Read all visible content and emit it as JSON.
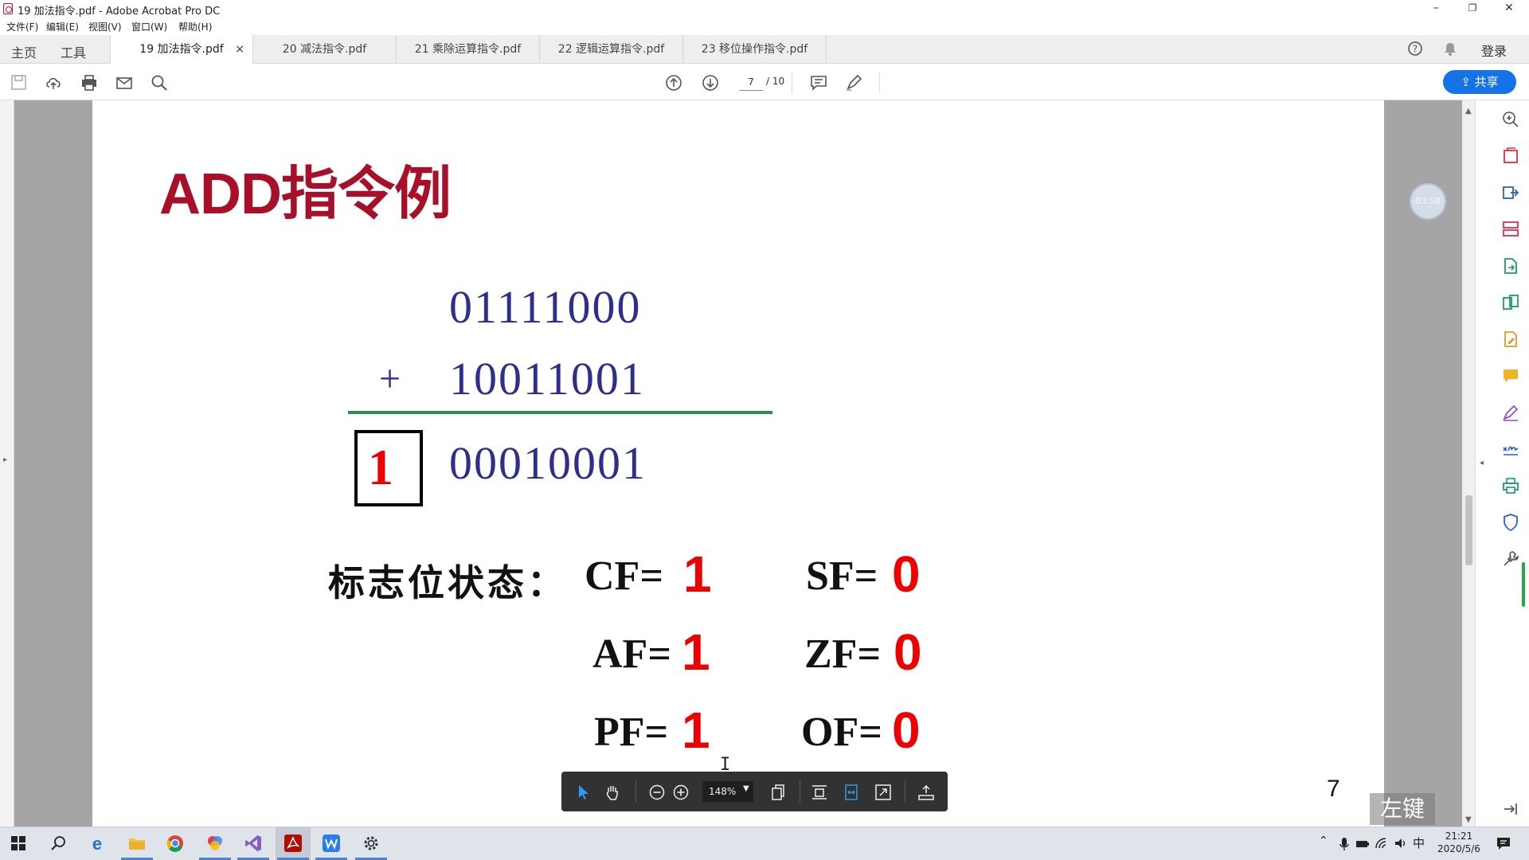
{
  "window": {
    "title": "19 加法指令.pdf - Adobe Acrobat Pro DC",
    "minimize": "–",
    "restore": "❐",
    "close": "✕"
  },
  "menu": [
    "文件(F)",
    "编辑(E)",
    "视图(V)",
    "窗口(W)",
    "帮助(H)"
  ],
  "nav": {
    "home": "主页",
    "tools": "工具",
    "login": "登录"
  },
  "tabs": [
    {
      "label": "19 加法指令.pdf",
      "close": "×"
    },
    {
      "label": "20 减法指令.pdf"
    },
    {
      "label": "21 乘除运算指令.pdf"
    },
    {
      "label": "22 逻辑运算指令.pdf"
    },
    {
      "label": "23 移位操作指令.pdf"
    }
  ],
  "toolbar": {
    "current_page": "7",
    "total_pages": "/ 10",
    "share_label": "共享"
  },
  "slide": {
    "title": "ADD指令例",
    "operand1": "01111000",
    "plus": "+",
    "operand2": "10011001",
    "carry": "1",
    "result": "00010001",
    "flags_label": "标志位状态：",
    "flags": [
      {
        "name": "CF=",
        "value": "1"
      },
      {
        "name": "SF=",
        "value": "0"
      },
      {
        "name": "AF=",
        "value": "1"
      },
      {
        "name": "ZF=",
        "value": "0"
      },
      {
        "name": "PF=",
        "value": "1"
      },
      {
        "name": "OF=",
        "value": "0"
      }
    ],
    "page_number": "7"
  },
  "overlay": {
    "watermark": "左键",
    "timer": "03:58"
  },
  "floating_toolbar": {
    "zoom": "148%"
  },
  "taskbar": {
    "time": "21:21",
    "date": "2020/5/6",
    "ime": "中"
  },
  "colors": {
    "title_red": "#a8102a",
    "number_blue": "#2e2e8c",
    "flag_red": "#e00000",
    "share_blue": "#1473e6",
    "rule_green": "#2e8b57"
  }
}
